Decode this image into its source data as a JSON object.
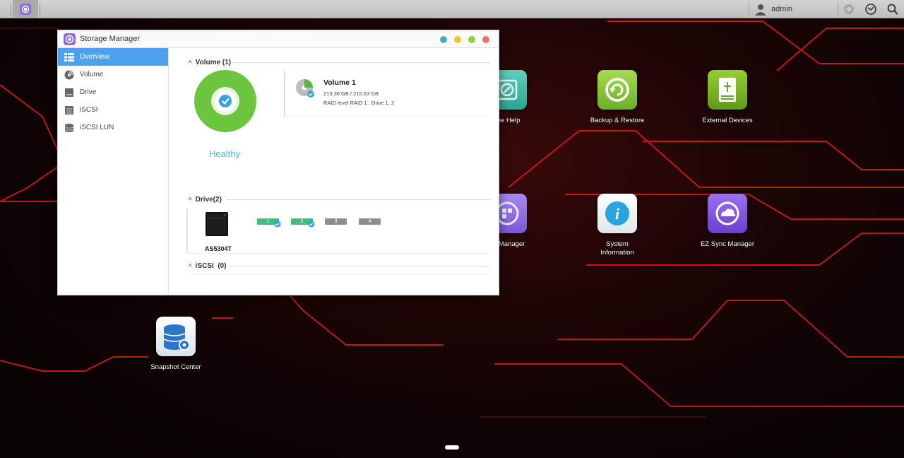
{
  "taskbar": {
    "user": "admin"
  },
  "desktop_icons": [
    {
      "id": "online-help",
      "label": "line Help",
      "color": "#3bb3a6"
    },
    {
      "id": "backup-restore",
      "label": "Backup & Restore",
      "color": "#8cc63f"
    },
    {
      "id": "external-devices",
      "label": "External Devices",
      "color": "#7bb521"
    },
    {
      "id": "storage-manager",
      "label": "ge Manager",
      "color": "#8e6fe0"
    },
    {
      "id": "system-information",
      "label": "System\nInformation",
      "color": "#2f9fd8"
    },
    {
      "id": "ez-sync-manager",
      "label": "EZ Sync Manager",
      "color": "#7b52d6"
    },
    {
      "id": "snapshot-center",
      "label": "Snapshot Center",
      "color": "#2a73c6"
    }
  ],
  "window": {
    "title": "Storage Manager",
    "sidebar": [
      {
        "label": "Overview",
        "icon": "overview-list-icon",
        "active": true
      },
      {
        "label": "Volume",
        "icon": "volume-disc-icon",
        "active": false
      },
      {
        "label": "Drive",
        "icon": "drive-icon",
        "active": false
      },
      {
        "label": "iSCSI",
        "icon": "iscsi-icon",
        "active": false
      },
      {
        "label": "iSCSI LUN",
        "icon": "iscsi-lun-icon",
        "active": false
      }
    ],
    "sections": {
      "volume": {
        "heading": "Volume (1)"
      },
      "drive": {
        "heading": "Drive(2)"
      },
      "iscsi": {
        "heading": "iSCSI  (0)"
      }
    },
    "health": {
      "status": "Healthy",
      "color": "#6cc43f"
    },
    "volume_card": {
      "name": "Volume 1",
      "capacity": "213.36 GB / 215.63 GB",
      "raid": "RAID level RAID 1 : Drive 1, 2"
    },
    "drive_card": {
      "model": "AS5304T",
      "slots": [
        {
          "number": "1",
          "state": "active",
          "color": "#3fbf7f"
        },
        {
          "number": "2",
          "state": "active",
          "color": "#3fbf7f"
        },
        {
          "number": "3",
          "state": "empty",
          "color": "#8a8f94"
        },
        {
          "number": "4",
          "state": "empty",
          "color": "#8a8f94"
        }
      ]
    }
  }
}
